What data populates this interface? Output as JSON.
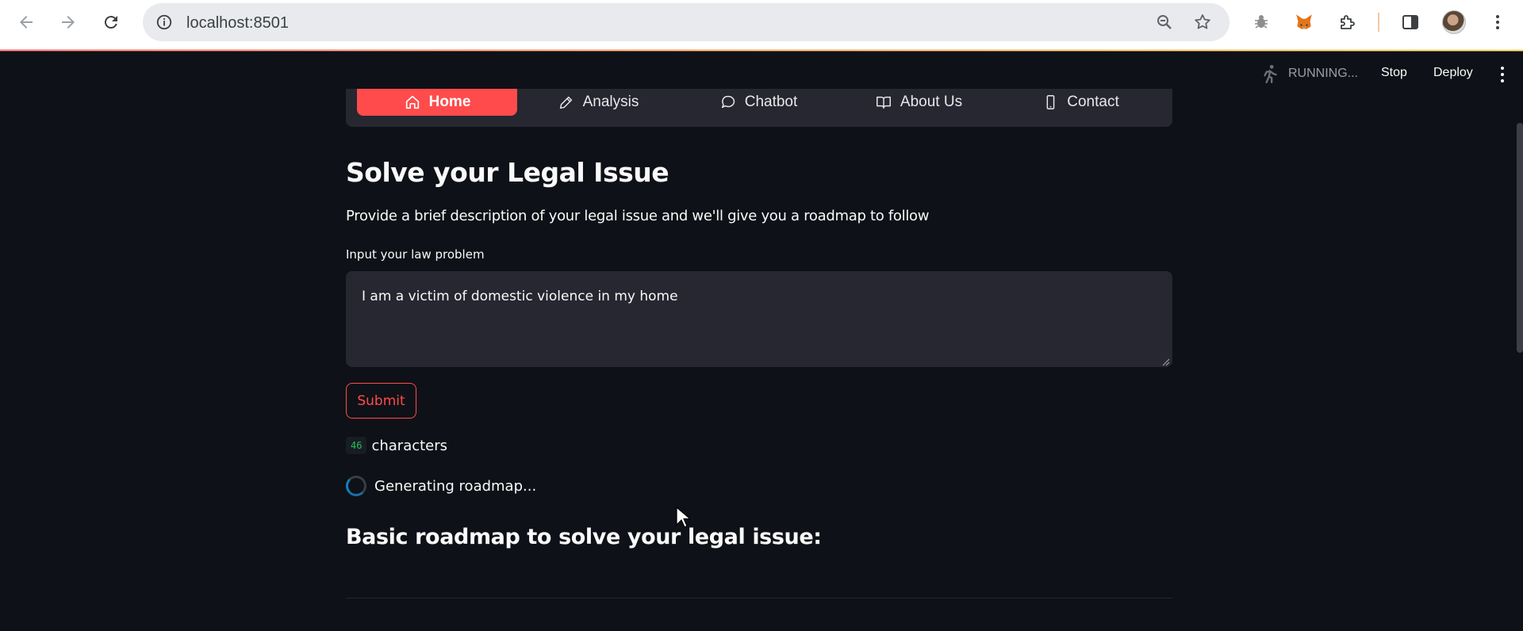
{
  "browser": {
    "url": "localhost:8501",
    "icons": [
      "back-arrow-icon",
      "forward-arrow-icon",
      "reload-icon",
      "site-info-icon",
      "zoom-icon",
      "bookmark-star-icon",
      "bug-extension-icon",
      "metamask-fox-icon",
      "extensions-puzzle-icon",
      "side-panel-icon",
      "profile-avatar",
      "menu-kebab-icon"
    ]
  },
  "app_header": {
    "status": "RUNNING...",
    "stop_label": "Stop",
    "deploy_label": "Deploy"
  },
  "nav": {
    "items": [
      {
        "label": "Home",
        "icon": "home-icon",
        "active": true
      },
      {
        "label": "Analysis",
        "icon": "pencil-icon",
        "active": false
      },
      {
        "label": "Chatbot",
        "icon": "chat-bubble-icon",
        "active": false
      },
      {
        "label": "About Us",
        "icon": "book-icon",
        "active": false
      },
      {
        "label": "Contact",
        "icon": "phone-icon",
        "active": false
      }
    ]
  },
  "main": {
    "title": "Solve your Legal Issue",
    "description": "Provide a brief description of your legal issue and we'll give you a roadmap to follow",
    "input_label": "Input your law problem",
    "input_value": "I am a victim of domestic violence in my home",
    "submit_label": "Submit",
    "char_count": "46",
    "char_label": "characters",
    "spinner_text": "Generating roadmap...",
    "roadmap_heading": "Basic roadmap to solve your legal issue:"
  },
  "colors": {
    "background": "#0e1117",
    "accent": "#ff4b4b",
    "surface": "#262730",
    "text": "#fafafa"
  }
}
